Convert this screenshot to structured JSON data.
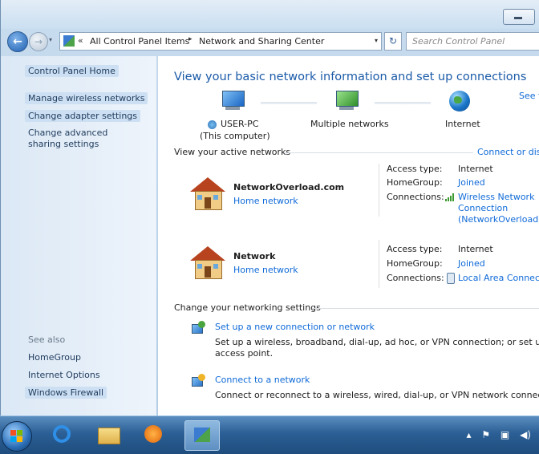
{
  "window": {
    "title": "Network and Sharing Center"
  },
  "nav": {
    "back_glyph": "←",
    "forward_glyph": "→",
    "dropdown_glyph": "▾",
    "chevron": "«",
    "crumbs": [
      "All Control Panel Items",
      "Network and Sharing Center"
    ],
    "crumb_sep": "▸",
    "refresh_glyph": "↻",
    "search_placeholder": "Search Control Panel"
  },
  "sidebar": {
    "items": [
      {
        "label": "Control Panel Home"
      },
      {
        "label": "Manage wireless networks"
      },
      {
        "label": "Change adapter settings"
      },
      {
        "label": "Change advanced sharing settings"
      }
    ],
    "see_also_label": "See also",
    "see_also": [
      {
        "label": "HomeGroup"
      },
      {
        "label": "Internet Options"
      },
      {
        "label": "Windows Firewall"
      }
    ]
  },
  "main": {
    "title": "View your basic network information and set up connections",
    "see_full_map": "See fu",
    "map": {
      "node1_name": "USER-PC",
      "node1_sub": "(This computer)",
      "node2_name": "Multiple networks",
      "node3_name": "Internet"
    },
    "active_title": "View your active networks",
    "connect_link": "Connect or disc",
    "networks": [
      {
        "name": "NetworkOverload.com",
        "type": "Home network",
        "access_label": "Access type:",
        "access_value": "Internet",
        "homegroup_label": "HomeGroup:",
        "homegroup_value": "Joined",
        "connections_label": "Connections:",
        "connection_line1": "Wireless Network",
        "connection_line2": "Connection",
        "connection_line3": "(NetworkOverload.co"
      },
      {
        "name": "Network",
        "type": "Home network",
        "access_label": "Access type:",
        "access_value": "Internet",
        "homegroup_label": "HomeGroup:",
        "homegroup_value": "Joined",
        "connections_label": "Connections:",
        "connection_line1": "Local Area Connecti"
      }
    ],
    "settings_title": "Change your networking settings",
    "actions": [
      {
        "title": "Set up a new connection or network",
        "desc1": "Set up a wireless, broadband, dial-up, ad hoc, or VPN connection; or set up a route",
        "desc2": "access point."
      },
      {
        "title": "Connect to a network",
        "desc1": "Connect or reconnect to a wireless, wired, dial-up, or VPN network connection."
      }
    ]
  },
  "taskbar": {
    "tray": [
      "▴",
      "⚑",
      "▣",
      "◀)"
    ]
  },
  "colors": {
    "link": "#0f6ad8",
    "heading": "#1a5aa8",
    "sidebar_bg": "#dbe8f5",
    "taskbar": "#2b5f95"
  }
}
